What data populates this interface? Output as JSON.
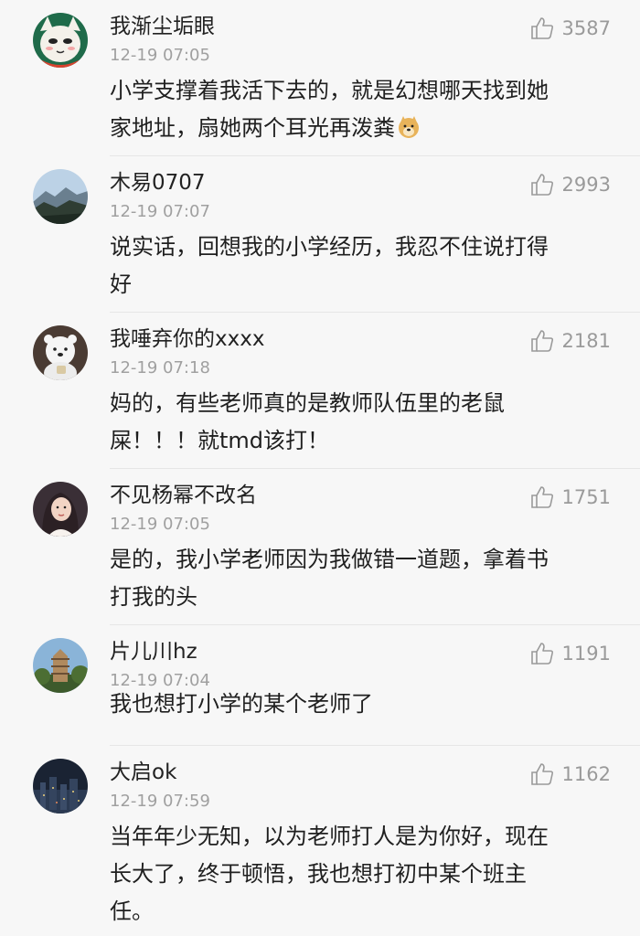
{
  "comments": [
    {
      "username": "我渐尘垢眼",
      "time": "12-19 07:05",
      "likes": "3587",
      "lines": [
        "小学支撑着我活下去的，就是幻想哪天找到她",
        "家地址，扇她两个耳光再泼粪"
      ],
      "avatar": "cartoon-face-avatar"
    },
    {
      "username": "木易0707",
      "time": "12-19 07:07",
      "likes": "2993",
      "lines": [
        "说实话，回想我的小学经历，我忍不住说打得",
        "好"
      ],
      "avatar": "mountain-landscape-avatar"
    },
    {
      "username": "我唾弃你的xxxx",
      "time": "12-19 07:18",
      "likes": "2181",
      "lines": [
        "妈的，有些老师真的是教师队伍里的老鼠",
        "屎！！！就tmd该打！"
      ],
      "avatar": "polar-bear-avatar"
    },
    {
      "username": "不见杨幂不改名",
      "time": "12-19 07:05",
      "likes": "1751",
      "lines": [
        "是的，我小学老师因为我做错一道题，拿着书",
        "打我的头"
      ],
      "avatar": "portrait-avatar"
    },
    {
      "username": "片儿川hz",
      "time": "12-19 07:04",
      "likes": "1191",
      "lines": [
        "我也想打小学的某个老师了"
      ],
      "avatar": "pagoda-avatar"
    },
    {
      "username": "大启ok",
      "time": "12-19 07:59",
      "likes": "1162",
      "lines": [
        "当年年少无知，以为老师打人是为你好，现在",
        "长大了，终于顿悟，我也想打初中某个班主",
        "任。"
      ],
      "avatar": "city-night-avatar"
    }
  ],
  "colors": {
    "background": "#f7f7f7",
    "meta_gray": "#a0a0a0",
    "like_gray": "#9a9a9a"
  },
  "icons": {
    "like": "thumbs-up-icon",
    "emoji": "doge-emoji-icon"
  }
}
